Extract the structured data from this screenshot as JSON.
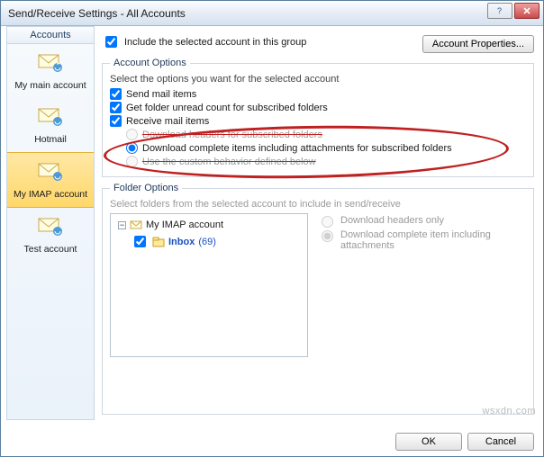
{
  "title": "Send/Receive Settings - All Accounts",
  "include_label": "Include the selected account in this group",
  "account_properties_btn": "Account Properties...",
  "sidebar": {
    "header": "Accounts",
    "items": [
      {
        "label": "My main account"
      },
      {
        "label": "Hotmail"
      },
      {
        "label": "My IMAP account"
      },
      {
        "label": "Test account"
      }
    ]
  },
  "account_options": {
    "legend": "Account Options",
    "hint": "Select the options you want for the selected account",
    "send": "Send mail items",
    "unread": "Get folder unread count for subscribed folders",
    "receive": "Receive mail items",
    "r_headers": "Download headers for subscribed folders",
    "r_complete": "Download complete items including attachments for subscribed folders",
    "r_custom": "Use the custom behavior defined below"
  },
  "folder_options": {
    "legend": "Folder Options",
    "hint": "Select folders from the selected account to include in send/receive",
    "tree": {
      "root": "My IMAP account",
      "inbox_label": "Inbox",
      "inbox_count": "(69)"
    },
    "r_headers": "Download headers only",
    "r_complete": "Download complete item including attachments"
  },
  "buttons": {
    "ok": "OK",
    "cancel": "Cancel"
  },
  "include_checked": true,
  "watermark": "wsxdn.com"
}
